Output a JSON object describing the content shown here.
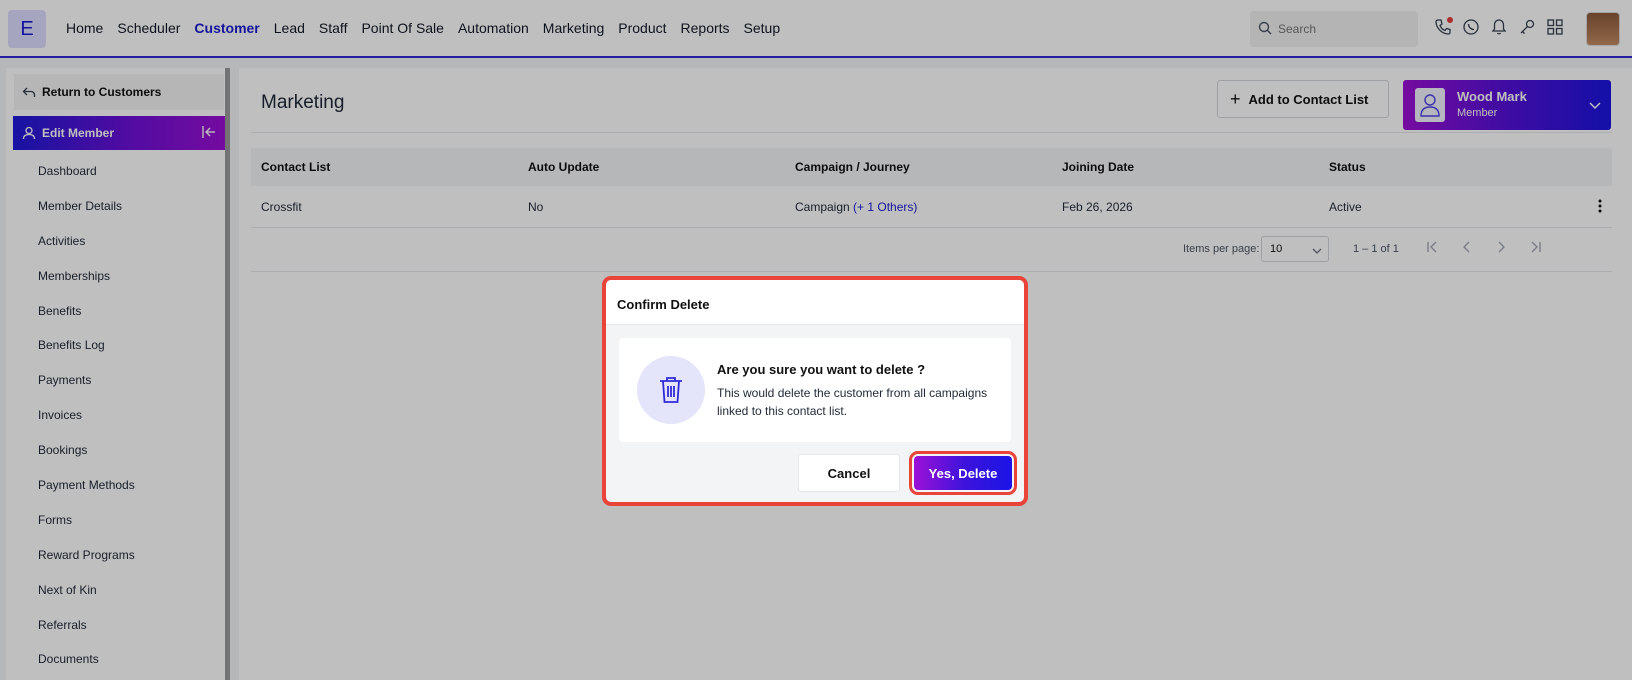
{
  "app": {
    "logo_letter": "E",
    "nav": [
      "Home",
      "Scheduler",
      "Customer",
      "Lead",
      "Staff",
      "Point Of Sale",
      "Automation",
      "Marketing",
      "Product",
      "Reports",
      "Setup"
    ],
    "active_nav": "Customer",
    "search_placeholder": "Search",
    "accent_color": "#1d1bd1",
    "top_icons": [
      "phone-call-icon",
      "whatsapp-icon",
      "bell-icon",
      "key-icon",
      "grid-apps-icon"
    ]
  },
  "sidebar": {
    "return_label": "Return to Customers",
    "section_label": "Edit Member",
    "items": [
      "Dashboard",
      "Member Details",
      "Activities",
      "Memberships",
      "Benefits",
      "Benefits Log",
      "Payments",
      "Invoices",
      "Bookings",
      "Payment Methods",
      "Forms",
      "Reward Programs",
      "Next of Kin",
      "Referrals",
      "Documents"
    ]
  },
  "main": {
    "title": "Marketing",
    "add_button": "Add to Contact List",
    "member": {
      "name": "Wood Mark",
      "role": "Member"
    },
    "table": {
      "headers": [
        "Contact List",
        "Auto Update",
        "Campaign / Journey",
        "Joining Date",
        "Status"
      ],
      "rows": [
        {
          "contact_list": "Crossfit",
          "auto_update": "No",
          "campaign": "Campaign",
          "campaign_more": "(+ 1 Others)",
          "joining_date": "Feb 26, 2026",
          "status": "Active"
        }
      ]
    },
    "pagination": {
      "items_per_page_label": "Items per page:",
      "items_per_page": "10",
      "range": "1 – 1 of 1"
    }
  },
  "modal": {
    "title": "Confirm Delete",
    "question": "Are you sure you want to delete ?",
    "description": "This would delete the customer from all campaigns linked to this contact list.",
    "cancel_label": "Cancel",
    "confirm_label": "Yes, Delete",
    "highlight_color": "#e8443a"
  }
}
